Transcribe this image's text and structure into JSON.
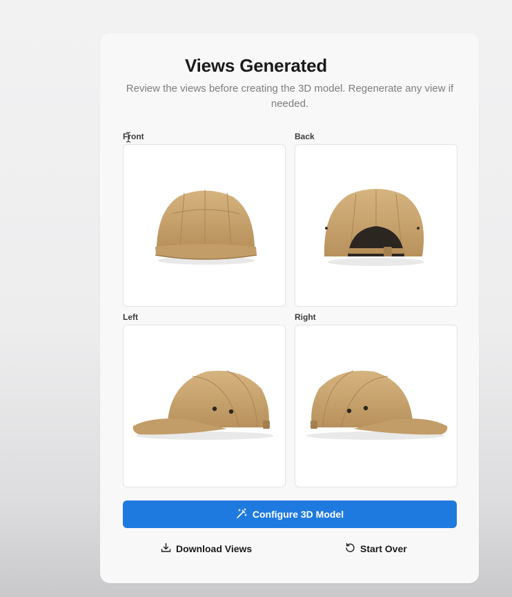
{
  "header": {
    "title": "Views Generated",
    "subtitle": "Review the views before creating the 3D model. Regenerate any view if needed."
  },
  "views": [
    {
      "label": "Front",
      "image": "khaki cap front view"
    },
    {
      "label": "Back",
      "image": "khaki cap back view"
    },
    {
      "label": "Left",
      "image": "khaki cap left side view"
    },
    {
      "label": "Right",
      "image": "khaki cap right side view"
    }
  ],
  "actions": {
    "configure_label": "Configure 3D Model",
    "configure_icon": "magic-wand-icon",
    "download_label": "Download Views",
    "download_icon": "download-icon",
    "start_over_label": "Start Over",
    "start_over_icon": "rotate-ccw-icon"
  },
  "colors": {
    "accent": "#1f7ae0",
    "cap": "#c8a574"
  }
}
